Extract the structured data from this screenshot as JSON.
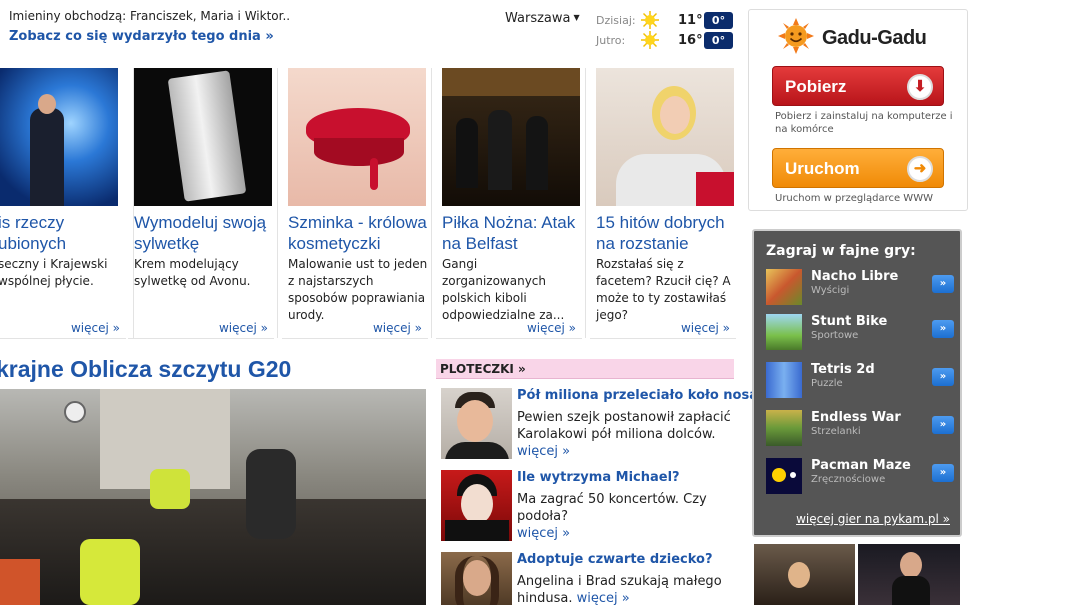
{
  "top": {
    "nameday": "Imieniny obchodzą: Franciszek, Maria i Wiktor..",
    "day_link": "Zobacz co się wydarzyło tego dnia »"
  },
  "weather": {
    "city": "Warszawa",
    "rows": [
      {
        "label": "Dzisiaj:",
        "temp": "11°",
        "night": "0°"
      },
      {
        "label": "Jutro:",
        "temp": "16°",
        "night": "0°"
      }
    ]
  },
  "cards": [
    {
      "title": "is rzeczy\nubionych",
      "desc": "seczny i Krajewski\nwspólnej płycie.",
      "more": "więcej »"
    },
    {
      "title": "Wymodeluj swoją sylwetkę",
      "desc": "Krem modelujący sylwetkę od Avonu.",
      "more": "więcej »"
    },
    {
      "title": "Szminka - królowa kosmetyczki",
      "desc": "Malowanie ust to jeden z najstarszych sposobów poprawiania urody.",
      "more": "więcej »"
    },
    {
      "title": "Piłka Nożna: Atak na Belfast",
      "desc": "Gangi zorganizowanych polskich kiboli odpowiedzialne za...",
      "more": "więcej »"
    },
    {
      "title": "15 hitów dobrych na rozstanie",
      "desc": "Rozstałaś się z facetem? Rzucił cię? A może to ty zostawiłaś jego?",
      "more": "więcej »"
    }
  ],
  "main_story": {
    "headline": "krajne Oblicza szczytu G20"
  },
  "ploteczki": {
    "header": "PLOTECZKI »",
    "items": [
      {
        "title": "Pół miliona przeleciało koło nosa",
        "desc": "Pewien szejk postanowił zapłacić Karolakowi pół miliona dolców.",
        "more": "więcej »"
      },
      {
        "title": "Ile wytrzyma Michael?",
        "desc": "Ma zagrać 50 koncertów. Czy podoła?",
        "more": "więcej »"
      },
      {
        "title": "Adoptuje czwarte dziecko?",
        "desc": "Angelina i Brad szukają małego hindusa.",
        "more": "więcej »"
      }
    ]
  },
  "gadugadu": {
    "logo": "Gadu-Gadu",
    "download_label": "Pobierz",
    "download_note": "Pobierz i zainstaluj na komputerze i na komórce",
    "run_label": "Uruchom",
    "run_note": "Uruchom w przeglądarce WWW"
  },
  "games": {
    "header": "Zagraj w fajne gry:",
    "items": [
      {
        "name": "Nacho Libre",
        "category": "Wyścigi"
      },
      {
        "name": "Stunt Bike",
        "category": "Sportowe"
      },
      {
        "name": "Tetris 2d",
        "category": "Puzzle"
      },
      {
        "name": "Endless War",
        "category": "Strzelanki"
      },
      {
        "name": "Pacman Maze",
        "category": "Zręcznościowe"
      }
    ],
    "more": "więcej gier na pykam.pl »"
  },
  "colors": {
    "link_blue": "#1f56a8",
    "badge_navy": "#0b2c6c",
    "gg_red": "#c51c22",
    "gg_orange": "#f08a06",
    "games_bg": "#555555",
    "ploteczki_pink": "#f9d5e8"
  }
}
